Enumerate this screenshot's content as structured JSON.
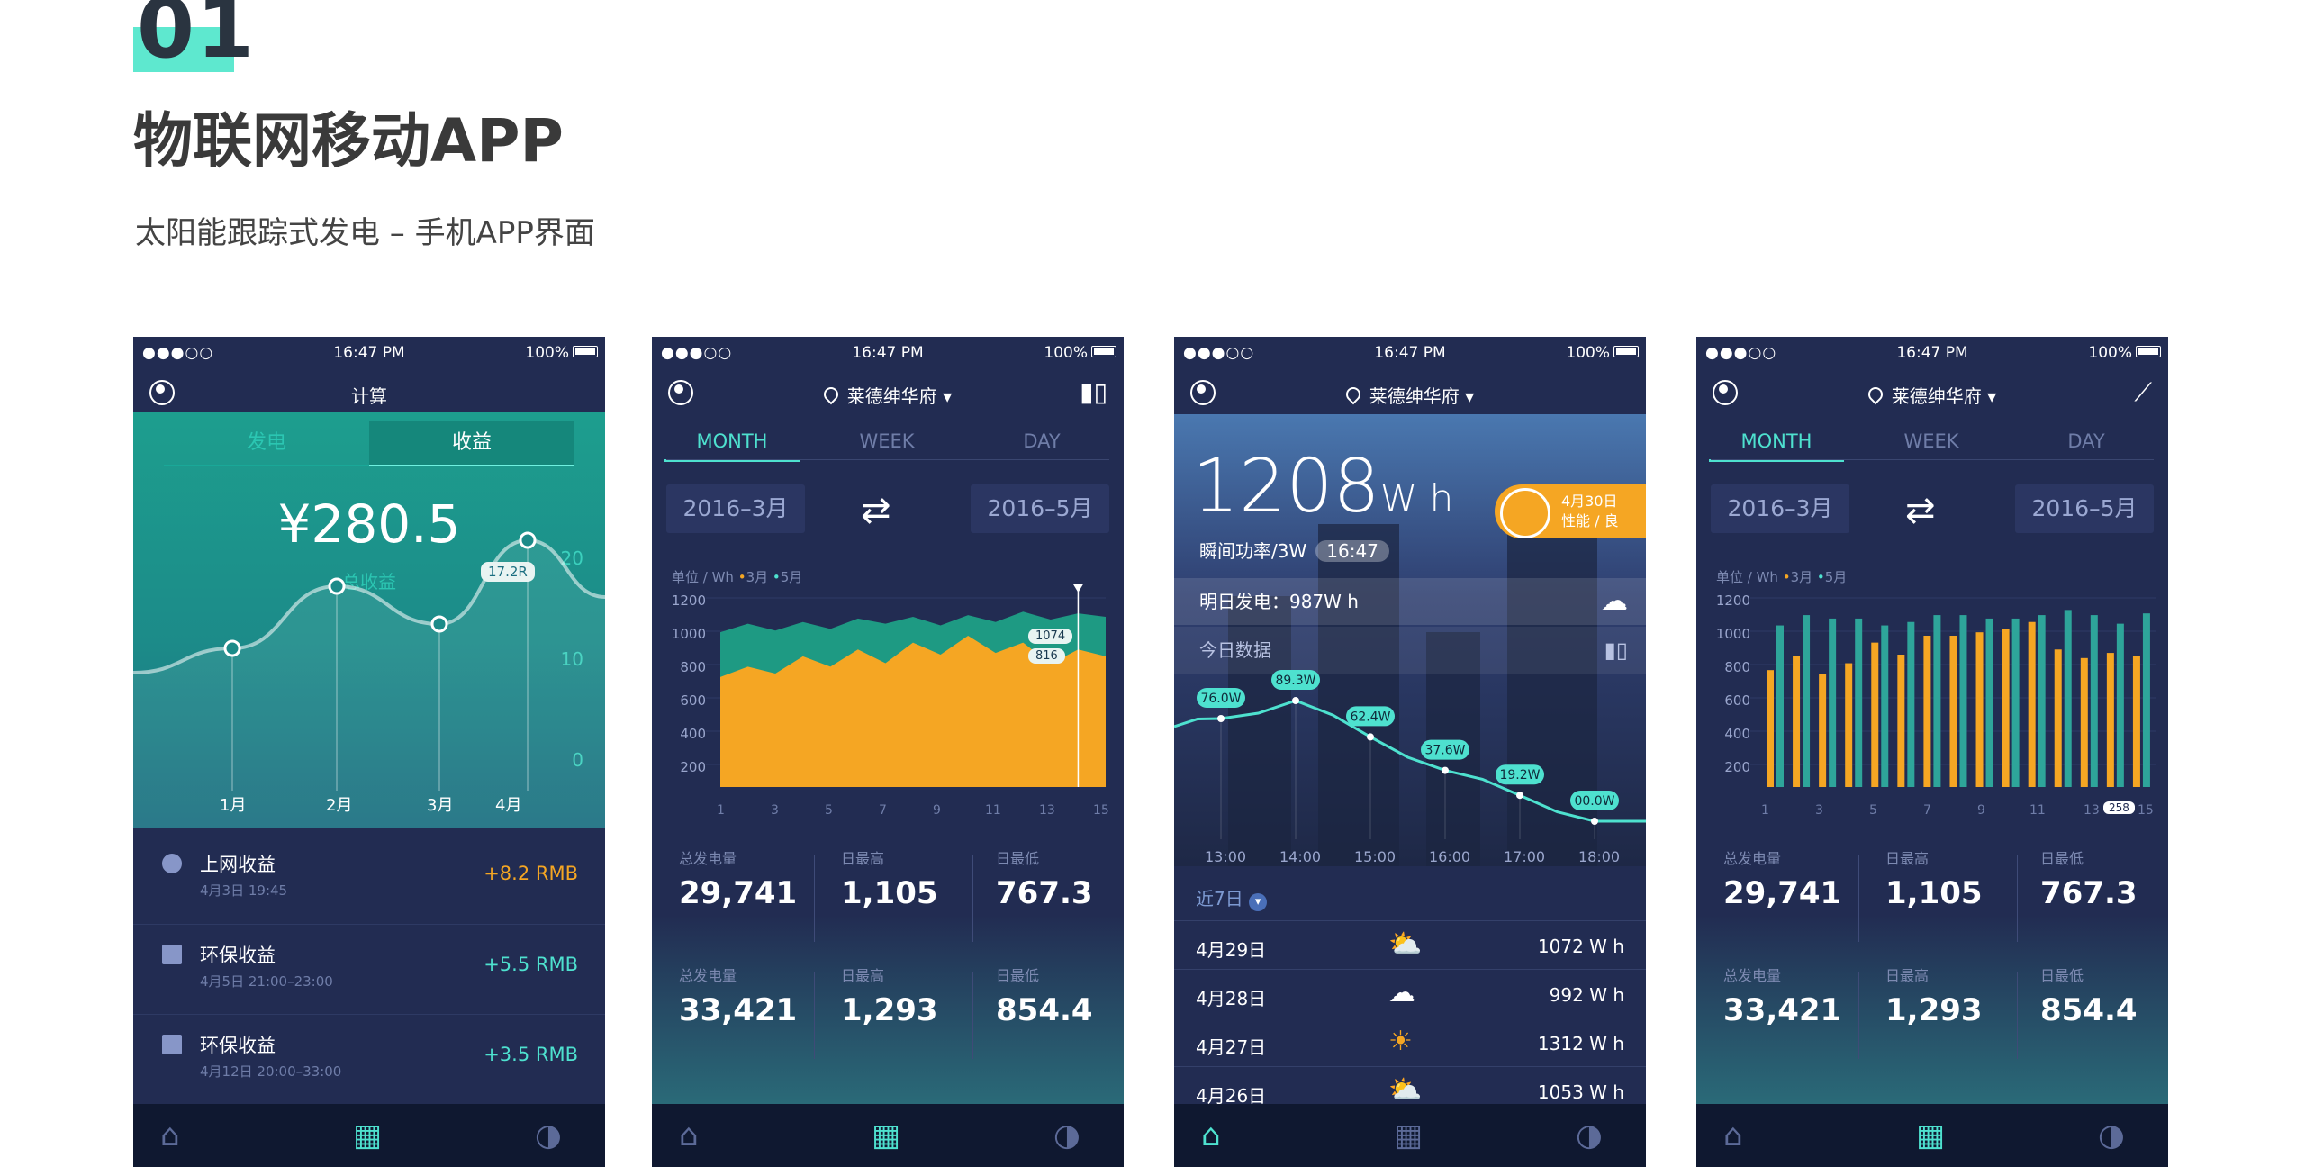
{
  "header": {
    "number": "01",
    "title": "物联网移动APP",
    "subtitle": "太阳能跟踪式发电 – 手机APP界面"
  },
  "status_bar": {
    "signal": "●●●○○",
    "time": "16:47 PM",
    "battery": "100%"
  },
  "screen1": {
    "nav_title": "计算",
    "segments": [
      "发电",
      "收益"
    ],
    "amount": "¥280.5",
    "amount_label": "总收益",
    "tooltip": "17.2R",
    "y_ticks": [
      "20",
      "10",
      "0"
    ],
    "x_labels": [
      "1月",
      "2月",
      "3月",
      "4月"
    ],
    "chart_data": {
      "type": "line",
      "x": [
        "1月",
        "2月",
        "3月",
        "4月"
      ],
      "values": [
        9.2,
        13.8,
        11.0,
        17.2
      ],
      "ylim": [
        0,
        20
      ]
    },
    "list": [
      {
        "title": "上网收益",
        "sub": "4月3日  19:45",
        "value": "+8.2 RMB",
        "color": "#f5a623"
      },
      {
        "title": "环保收益",
        "sub": "4月5日  21:00–23:00",
        "value": "+5.5 RMB",
        "color": "#4ee1cf"
      },
      {
        "title": "环保收益",
        "sub": "4月12日  20:00–33:00",
        "value": "+3.5 RMB",
        "color": "#4ee1cf"
      }
    ]
  },
  "location": "莱德绅华府",
  "tabs": [
    "MONTH",
    "WEEK",
    "DAY"
  ],
  "date_range": {
    "from": "2016–3月",
    "to": "2016–5月"
  },
  "legend": {
    "unit": "单位 / Wh",
    "s1": "3月",
    "s2": "5月"
  },
  "y_ticks_wh": [
    "1200",
    "1000",
    "800",
    "600",
    "400",
    "200"
  ],
  "x_ticks": [
    "1",
    "3",
    "5",
    "7",
    "9",
    "11",
    "13",
    "15"
  ],
  "screen2": {
    "chart_data": {
      "type": "area",
      "x": [
        1,
        2,
        3,
        4,
        5,
        6,
        7,
        8,
        9,
        10,
        11,
        12,
        13,
        14,
        15
      ],
      "ylim": [
        100,
        1200
      ],
      "series": [
        {
          "name": "5月",
          "color": "#1e9a83",
          "values": [
            1000,
            1050,
            1010,
            1060,
            1020,
            1080,
            1050,
            1090,
            1040,
            1100,
            1060,
            1120,
            1074,
            1110,
            1090
          ]
        },
        {
          "name": "3月",
          "color": "#f5a623",
          "values": [
            740,
            800,
            760,
            860,
            800,
            900,
            820,
            940,
            870,
            980,
            880,
            940,
            816,
            900,
            860
          ]
        }
      ]
    },
    "tooltips": [
      "1074",
      "816"
    ]
  },
  "stats_top": [
    {
      "label": "总发电量",
      "value": "29,741"
    },
    {
      "label": "日最高",
      "value": "1,105"
    },
    {
      "label": "日最低",
      "value": "767.3"
    }
  ],
  "stats_bottom": [
    {
      "label": "总发电量",
      "value": "33,421"
    },
    {
      "label": "日最高",
      "value": "1,293"
    },
    {
      "label": "日最低",
      "value": "854.4"
    }
  ],
  "screen3": {
    "power": "1208",
    "power_unit": "W h",
    "badge_date": "4月30日",
    "badge_text": "性能 / 良",
    "instant": "瞬间功率/3W",
    "instant_time": "16:47",
    "tomorrow": "明日发电：987W h",
    "today": "今日数据",
    "chart_data": {
      "type": "line",
      "x": [
        "13:00",
        "14:00",
        "15:00",
        "16:00",
        "17:00",
        "18:00"
      ],
      "values": [
        76.0,
        89.3,
        62.4,
        37.6,
        19.2,
        0.0
      ],
      "point_labels": [
        "76.0W",
        "89.3W",
        "62.4W",
        "37.6W",
        "19.2W",
        "00.0W"
      ]
    },
    "recent": "近7日",
    "days": [
      {
        "date": "4月29日",
        "icon": "sun-cloud-icon",
        "value": "1072 W h"
      },
      {
        "date": "4月28日",
        "icon": "cloud-icon",
        "value": "992 W h"
      },
      {
        "date": "4月27日",
        "icon": "sun-icon",
        "value": "1312 W h"
      },
      {
        "date": "4月26日",
        "icon": "sun-cloud-icon",
        "value": "1053 W h"
      }
    ]
  },
  "screen4": {
    "chart_data": {
      "type": "bar",
      "x": [
        1,
        2,
        3,
        4,
        5,
        6,
        7,
        8,
        9,
        10,
        11,
        12,
        13,
        14,
        15
      ],
      "ylim": [
        100,
        1200
      ],
      "series": [
        {
          "name": "3月",
          "color": "#f5a623",
          "values": [
            780,
            860,
            760,
            820,
            940,
            870,
            980,
            980,
            1000,
            1020,
            1060,
            900,
            850,
            880,
            860
          ]
        },
        {
          "name": "5月",
          "color": "#2ea59a",
          "values": [
            1040,
            1100,
            1080,
            1080,
            1040,
            1060,
            1100,
            1100,
            1080,
            1080,
            1100,
            1130,
            1100,
            1050,
            1110
          ]
        }
      ]
    },
    "tooltip": "258"
  },
  "colors": {
    "accent": "#4ee1cf",
    "orange": "#f5a623",
    "bg": "#222c52"
  }
}
